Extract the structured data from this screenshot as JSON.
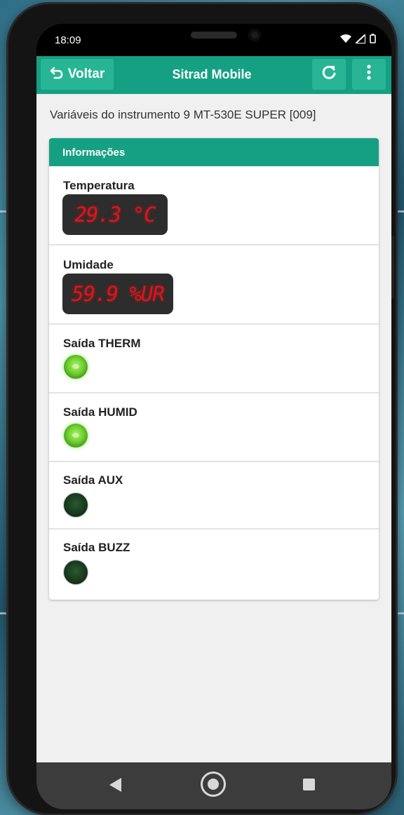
{
  "status_bar": {
    "time": "18:09",
    "icons": [
      "wifi-icon",
      "signal-icon",
      "battery-icon"
    ]
  },
  "toolbar": {
    "back_label": "Voltar",
    "back_icon": "undo-arrow-icon",
    "title": "Sitrad Mobile",
    "refresh_icon": "refresh-icon",
    "menu_icon": "more-vertical-icon",
    "accent_color": "#16a083"
  },
  "content": {
    "heading": "Variáveis do instrumento 9 MT-530E SUPER [009]"
  },
  "panel": {
    "header": "Informações",
    "variables": [
      {
        "label": "Temperatura",
        "display": "29.3 °C"
      },
      {
        "label": "Umidade",
        "display": "59.9 %UR"
      }
    ],
    "outputs": [
      {
        "label": "Saída THERM",
        "state": "on"
      },
      {
        "label": "Saída HUMID",
        "state": "on"
      },
      {
        "label": "Saída AUX",
        "state": "off"
      },
      {
        "label": "Saída BUZZ",
        "state": "off"
      }
    ],
    "colors": {
      "led_on": "#6fcf30",
      "led_off": "#183a1d",
      "display_text": "#e0131b",
      "display_bg": "#2d2d2d"
    }
  },
  "nav_bar": {
    "icons": [
      "back-triangle-icon",
      "home-circle-icon",
      "recent-square-icon"
    ]
  }
}
